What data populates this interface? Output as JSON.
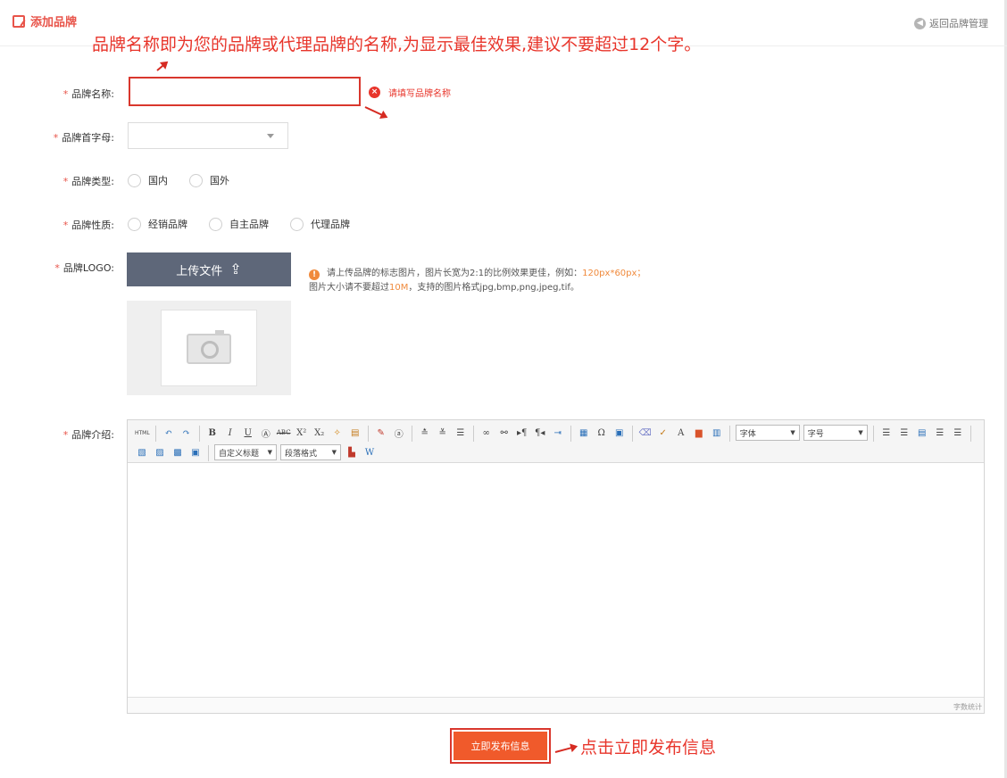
{
  "header": {
    "title": "添加品牌",
    "back_link": "返回品牌管理"
  },
  "annotations": {
    "name_hint": "品牌名称即为您的品牌或代理品牌的名称,为显示最佳效果,建议不要超过12个字。",
    "submit_hint": "点击立即发布信息"
  },
  "form": {
    "required_mark": "*",
    "brand_name": {
      "label": "品牌名称:",
      "value": "",
      "error": "请填写品牌名称"
    },
    "first_letter": {
      "label": "品牌首字母:",
      "value": ""
    },
    "brand_type": {
      "label": "品牌类型:",
      "options": [
        "国内",
        "国外"
      ]
    },
    "brand_nature": {
      "label": "品牌性质:",
      "options": [
        "经销品牌",
        "自主品牌",
        "代理品牌"
      ]
    },
    "logo": {
      "label": "品牌LOGO:",
      "upload_label": "上传文件",
      "tip_line1_prefix": "请上传品牌的标志图片，图片长宽为2:1的比例效果更佳，例如：",
      "tip_line1_highlight": "120px*60px；",
      "tip_line2_prefix": "图片大小请不要超过",
      "tip_line2_highlight": "10M",
      "tip_line2_suffix": "，支持的图片格式jpg,bmp,png,jpeg,tif。"
    },
    "intro": {
      "label": "品牌介绍:",
      "font_select": "字体",
      "size_select": "字号",
      "heading_select": "自定义标题",
      "paragraph_select": "段落格式",
      "html_button": "HTML",
      "word_count": "字数统计"
    }
  },
  "submit_label": "立即发布信息",
  "colors": {
    "accent_red": "#e8352b",
    "submit_bg": "#f05a2b",
    "upload_bg": "#5e6779",
    "tip_highlight": "#f08a3c"
  }
}
